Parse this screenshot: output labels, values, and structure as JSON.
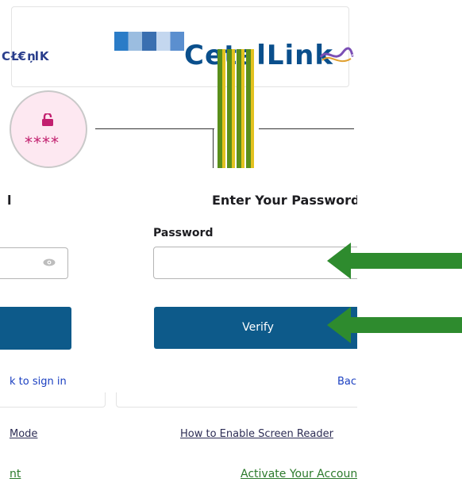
{
  "header": {
    "logo_text": "CetalLink",
    "garbled_text": "C Ł€ ņl K"
  },
  "lock_avatar": {
    "icon": "lock-icon",
    "masked_text": "****",
    "color": "#c2206f"
  },
  "left_panel": {
    "label_partial": "l",
    "back_link_partial": "k to sign in",
    "footer_link_1_partial": "Mode",
    "footer_link_2_partial": "nt"
  },
  "main": {
    "heading": "Enter Your Password",
    "password_label": "Password",
    "password_value": "",
    "verify_label": "Verify",
    "back_link_partial": "Bac",
    "screen_reader_link": "How to Enable Screen Reader",
    "activate_link": "Activate Your Account"
  },
  "annotations": [
    {
      "icon": "arrow-left-icon",
      "color": "#2e8b2e"
    },
    {
      "icon": "arrow-left-icon",
      "color": "#2e8b2e"
    }
  ],
  "colors": {
    "primary_button": "#0d5a8a",
    "link_blue": "#1a3fc1",
    "link_green": "#2c7a2c"
  }
}
